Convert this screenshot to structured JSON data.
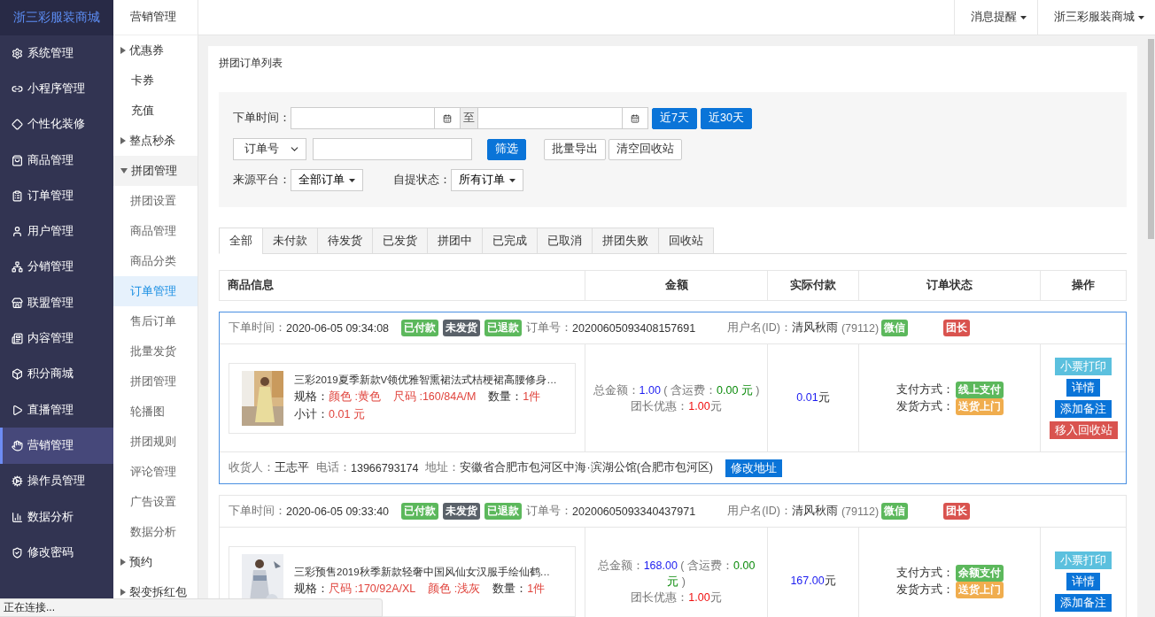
{
  "brand": "浙三彩服装商城",
  "sidebar": {
    "items": [
      {
        "label": "系统管理",
        "selected": false
      },
      {
        "label": "小程序管理",
        "selected": false
      },
      {
        "label": "个性化装修",
        "selected": false
      },
      {
        "label": "商品管理",
        "selected": false
      },
      {
        "label": "订单管理",
        "selected": false
      },
      {
        "label": "用户管理",
        "selected": false
      },
      {
        "label": "分销管理",
        "selected": false
      },
      {
        "label": "联盟管理",
        "selected": false
      },
      {
        "label": "内容管理",
        "selected": false
      },
      {
        "label": "积分商城",
        "selected": false
      },
      {
        "label": "直播管理",
        "selected": false
      },
      {
        "label": "营销管理",
        "selected": true
      },
      {
        "label": "操作员管理",
        "selected": false
      },
      {
        "label": "数据分析",
        "selected": false
      },
      {
        "label": "修改密码",
        "selected": false
      }
    ]
  },
  "subnav": {
    "title": "营销管理",
    "items": [
      {
        "label": "优惠券",
        "kind": "group",
        "expanded": false
      },
      {
        "label": "卡券",
        "kind": "link",
        "selected": false
      },
      {
        "label": "充值",
        "kind": "link",
        "selected": false
      },
      {
        "label": "整点秒杀",
        "kind": "group",
        "expanded": false
      },
      {
        "label": "拼团管理",
        "kind": "group",
        "expanded": true,
        "children": [
          {
            "label": "拼团设置",
            "selected": false
          },
          {
            "label": "商品管理",
            "selected": false
          },
          {
            "label": "商品分类",
            "selected": false
          },
          {
            "label": "订单管理",
            "selected": true
          },
          {
            "label": "售后订单",
            "selected": false
          },
          {
            "label": "批量发货",
            "selected": false
          },
          {
            "label": "拼团管理",
            "selected": false
          },
          {
            "label": "轮播图",
            "selected": false
          },
          {
            "label": "拼团规则",
            "selected": false
          },
          {
            "label": "评论管理",
            "selected": false
          },
          {
            "label": "广告设置",
            "selected": false
          },
          {
            "label": "数据分析",
            "selected": false
          }
        ]
      },
      {
        "label": "预约",
        "kind": "group",
        "expanded": false
      },
      {
        "label": "裂变拆红包",
        "kind": "group",
        "expanded": false
      }
    ]
  },
  "topbar": {
    "menus": [
      "消息提醒",
      "浙三彩服装商城"
    ]
  },
  "page_title": "拼团订单列表",
  "filters": {
    "date_label": "下单时间：",
    "date_to": "至",
    "quick_ranges": [
      "近7天",
      "近30天"
    ],
    "search_type": "订单号",
    "filter_button": "筛选",
    "actions": [
      "批量导出",
      "清空回收站"
    ],
    "source_label": "来源平台：",
    "source_value": "全部订单",
    "pickup_label": "自提状态：",
    "pickup_value": "所有订单"
  },
  "tabs": [
    {
      "label": "全部",
      "selected": true
    },
    {
      "label": "未付款",
      "selected": false
    },
    {
      "label": "待发货",
      "selected": false
    },
    {
      "label": "已发货",
      "selected": false
    },
    {
      "label": "拼团中",
      "selected": false
    },
    {
      "label": "已完成",
      "selected": false
    },
    {
      "label": "已取消",
      "selected": false
    },
    {
      "label": "拼团失败",
      "selected": false
    },
    {
      "label": "回收站",
      "selected": false
    }
  ],
  "table": {
    "columns": [
      "商品信息",
      "金额",
      "实际付款",
      "订单状态",
      "操作"
    ]
  },
  "orders": [
    {
      "selected": true,
      "time_label": "下单时间：",
      "time": "2020-06-05 09:34:08",
      "badges": [
        {
          "text": "已付款",
          "color": "#5cb85c"
        },
        {
          "text": "未发货",
          "color": "#5a6169"
        },
        {
          "text": "已退款",
          "color": "#5cb85c"
        }
      ],
      "order_no_label": "订单号：",
      "order_no": "20200605093408157691",
      "user_label": "用户名(ID)：",
      "user_name": "清风秋雨",
      "user_id": "(79112)",
      "user_badges": [
        {
          "text": "微信",
          "color": "#5cb85c"
        },
        {
          "text": "团长",
          "color": "#d9534f"
        }
      ],
      "product": {
        "title": "三彩2019夏季新款V领优雅智熏裙法式桔梗裙高腰修身…",
        "spec_label": "规格：",
        "specs": [
          "颜色 :黄色",
          "尺码 :160/84A/M"
        ],
        "qty_label": "数量：",
        "qty": "1件",
        "subtotal_label": "小计：",
        "subtotal": "0.01 元"
      },
      "amount": {
        "total_label": "总金额：",
        "total": "1.00",
        "shipping_open": "( 含运费：",
        "shipping": "0.00 元",
        "shipping_close": ")",
        "discount_label": "团长优惠：",
        "discount": "1.00",
        "unit": "元"
      },
      "paid": "0.01",
      "paid_unit": "元",
      "pay_label": "支付方式：",
      "pay_badge": {
        "text": "线上支付",
        "color": "#5cb85c"
      },
      "ship_label": "发货方式：",
      "ship_badge": {
        "text": "送货上门",
        "color": "#f0ad4e"
      },
      "actions": [
        {
          "label": "小票打印",
          "color": "#5bc0de"
        },
        {
          "label": "详情",
          "color": "#0a74d8"
        },
        {
          "label": "添加备注",
          "color": "#0a74d8"
        },
        {
          "label": "移入回收站",
          "color": "#d9534f"
        }
      ],
      "receiver": {
        "name_label": "收货人：",
        "name": "王志平",
        "phone_label": "电话：",
        "phone": "13966793174",
        "address_label": "地址：",
        "address": "安徽省合肥市包河区中海·滨湖公馆(合肥市包河区)",
        "edit_button": "修改地址"
      }
    },
    {
      "selected": false,
      "time_label": "下单时间：",
      "time": "2020-06-05 09:33:40",
      "badges": [
        {
          "text": "已付款",
          "color": "#5cb85c"
        },
        {
          "text": "未发货",
          "color": "#5a6169"
        },
        {
          "text": "已退款",
          "color": "#5cb85c"
        }
      ],
      "order_no_label": "订单号：",
      "order_no": "20200605093340437971",
      "user_label": "用户名(ID)：",
      "user_name": "清风秋雨",
      "user_id": "(79112)",
      "user_badges": [
        {
          "text": "微信",
          "color": "#5cb85c"
        },
        {
          "text": "团长",
          "color": "#d9534f"
        }
      ],
      "product": {
        "title": "三彩预售2019秋季新款轻奢中国风仙女汉服手绘仙鹤…",
        "spec_label": "规格：",
        "specs": [
          "尺码 :170/92A/XL",
          "颜色 :浅灰"
        ],
        "qty_label": "数量：",
        "qty": "1件"
      },
      "amount": {
        "total_label": "总金额：",
        "total": "168.00",
        "shipping_open": "( 含运费：",
        "shipping": "0.00 元",
        "shipping_close": ")",
        "discount_label": "团长优惠：",
        "discount": "1.00",
        "unit": "元"
      },
      "paid": "167.00",
      "paid_unit": "元",
      "pay_label": "支付方式：",
      "pay_badge": {
        "text": "余额支付",
        "color": "#5cb85c"
      },
      "ship_label": "发货方式：",
      "ship_badge": {
        "text": "送货上门",
        "color": "#f0ad4e"
      },
      "actions": [
        {
          "label": "小票打印",
          "color": "#5bc0de"
        },
        {
          "label": "详情",
          "color": "#0a74d8"
        },
        {
          "label": "添加备注",
          "color": "#0a74d8"
        }
      ]
    }
  ],
  "status_bar": "正在连接..."
}
